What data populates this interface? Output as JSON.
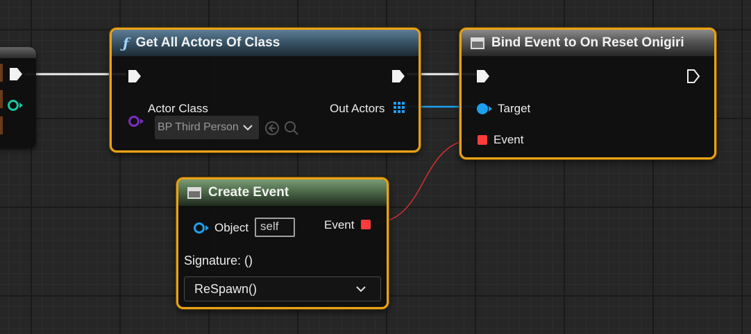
{
  "nodes": {
    "get_all_actors": {
      "title": "Get All Actors Of Class",
      "actor_class_label": "Actor Class",
      "actor_class_value": "BP Third Person",
      "out_actors_label": "Out Actors"
    },
    "bind_event": {
      "title": "Bind Event to On Reset Onigiri",
      "target_label": "Target",
      "event_label": "Event"
    },
    "create_event": {
      "title": "Create Event",
      "object_label": "Object",
      "object_value": "self",
      "event_label": "Event",
      "signature_label": "Signature: ()",
      "function_value": "ReSpawn()"
    }
  },
  "colors": {
    "selection": "#e8a217",
    "exec": "#f2f2f2",
    "object_pin": "#1ea0f0",
    "delegate_pin": "#ff3b3b",
    "class_pin": "#7b2fbf"
  },
  "icons": {
    "function": "f-icon",
    "event": "event-graph-icon",
    "array": "array-grid-icon",
    "dropdown": "chevron-down-icon",
    "use_selected": "arrow-left-circle-icon",
    "browse": "search-icon"
  }
}
